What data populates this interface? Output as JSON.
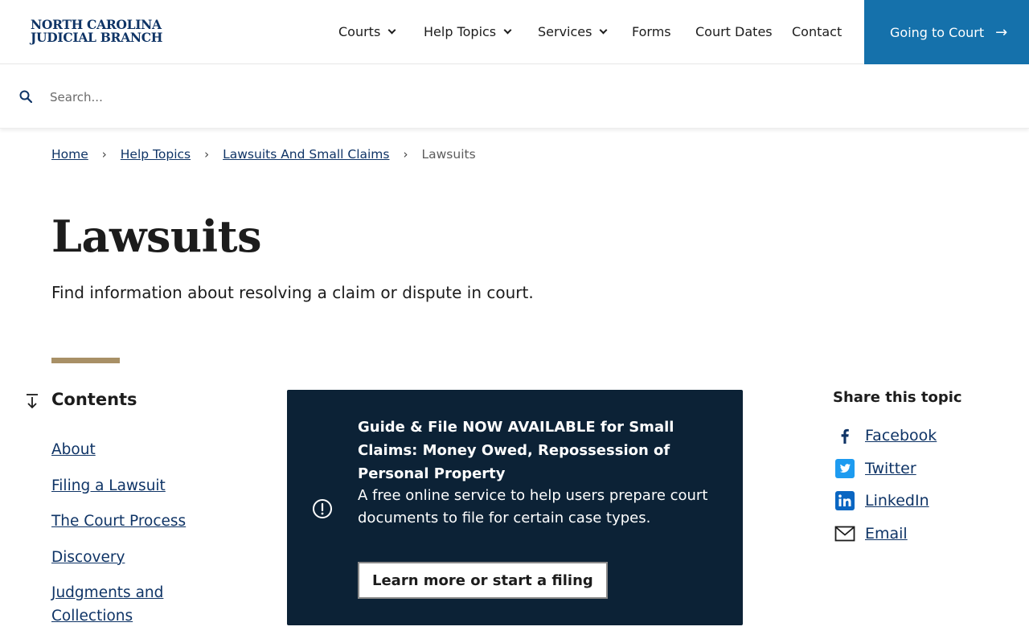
{
  "header": {
    "logo_line1": "NORTH CAROLINA",
    "logo_line2": "JUDICIAL BRANCH",
    "nav": [
      {
        "label": "Courts"
      },
      {
        "label": "Help Topics"
      },
      {
        "label": "Services"
      },
      {
        "label": "Forms"
      },
      {
        "label": "Court Dates"
      },
      {
        "label": "Contact"
      }
    ],
    "cta_label": "Going to Court",
    "cta_arrow": "→",
    "colors": {
      "brand": "#0f3466",
      "cta": "#1571ab"
    }
  },
  "search": {
    "placeholder": "Search...",
    "value": ""
  },
  "breadcrumb": {
    "items": [
      "Home",
      "Help Topics",
      "Lawsuits And Small Claims"
    ],
    "current": "Lawsuits",
    "separator": "›"
  },
  "page": {
    "title": "Lawsuits",
    "subtitle": "Find information about resolving a claim or dispute in court.",
    "accent_color": "#a89066"
  },
  "contents": {
    "title": "Contents",
    "items": [
      "About",
      "Filing a Lawsuit",
      "The Court Process",
      "Discovery",
      "Judgments and Collections"
    ]
  },
  "alert": {
    "heading": "Guide & File NOW AVAILABLE for Small Claims: Money Owed, Repossession of Personal Property",
    "body": "A free online service to help users prepare court documents to file for certain case types.",
    "button_label": "Learn more or start a filing",
    "background": "#0c2236"
  },
  "share": {
    "title": "Share this topic",
    "items": [
      {
        "label": "Facebook",
        "icon": "facebook-icon"
      },
      {
        "label": "Twitter",
        "icon": "twitter-icon"
      },
      {
        "label": "LinkedIn",
        "icon": "linkedin-icon"
      },
      {
        "label": "Email",
        "icon": "email-icon"
      }
    ]
  }
}
